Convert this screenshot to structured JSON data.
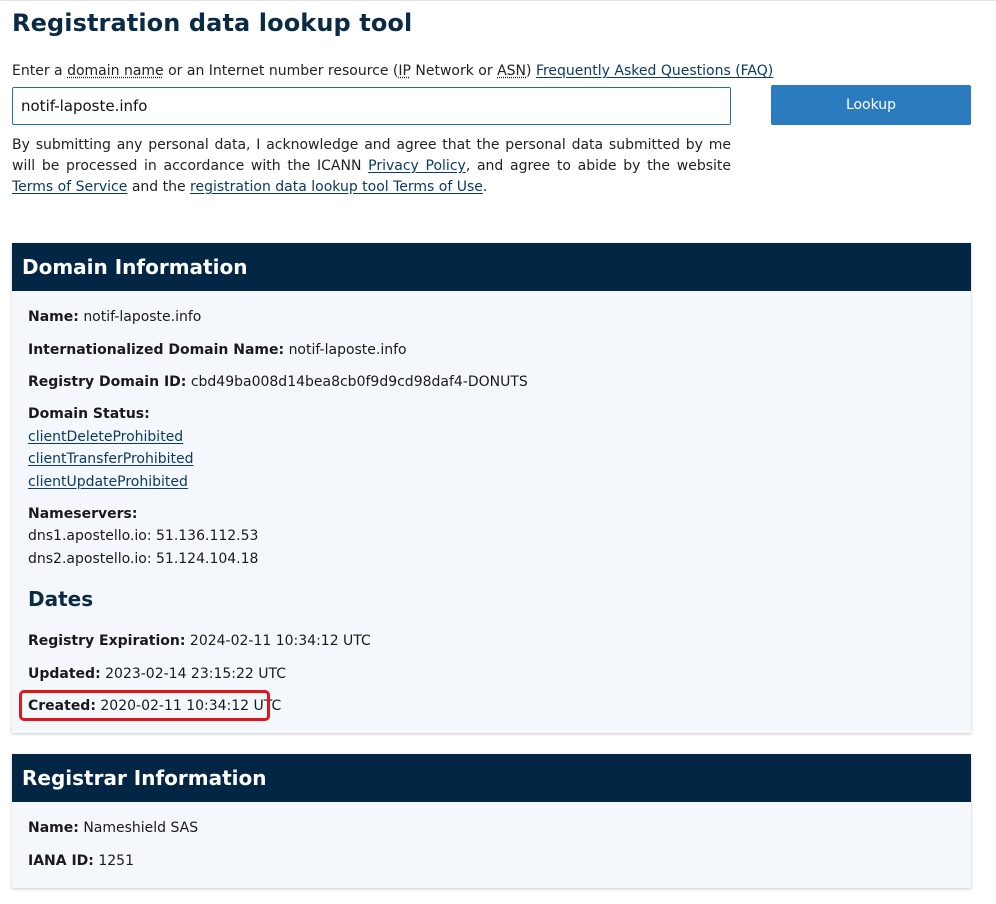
{
  "page": {
    "title": "Registration data lookup tool"
  },
  "search": {
    "prompt_prefix": "Enter a ",
    "prompt_domain_name": "domain name",
    "prompt_middle": " or an Internet number resource (",
    "prompt_ip": "IP",
    "prompt_network_or": " Network or ",
    "prompt_asn": "ASN",
    "prompt_suffix": ") ",
    "faq_link": "Frequently Asked Questions (FAQ)",
    "value": "notif-laposte.info",
    "lookup_label": "Lookup"
  },
  "consent": {
    "text1": "By submitting any personal data, I acknowledge and agree that the personal data submitted by me will be processed in accordance with the ICANN ",
    "privacy_link": "Privacy Policy",
    "text2": ", and agree to abide by the website ",
    "tos_link": "Terms of Service",
    "text3": " and the ",
    "terms_of_use_link": "registration data lookup tool Terms of Use",
    "text4": "."
  },
  "domain": {
    "header": "Domain Information",
    "name_label": "Name:",
    "name_value": "notif-laposte.info",
    "idn_label": "Internationalized Domain Name:",
    "idn_value": "notif-laposte.info",
    "registry_id_label": "Registry Domain ID:",
    "registry_id_value": "cbd49ba008d14bea8cb0f9d9cd98daf4-DONUTS",
    "status_label": "Domain Status:",
    "statuses": [
      "clientDeleteProhibited",
      "clientTransferProhibited",
      "clientUpdateProhibited"
    ],
    "nameservers_label": "Nameservers:",
    "nameservers": [
      "dns1.apostello.io: 51.136.112.53",
      "dns2.apostello.io: 51.124.104.18"
    ],
    "dates_heading": "Dates",
    "expiration_label": "Registry Expiration:",
    "expiration_value": "2024-02-11 10:34:12 UTC",
    "updated_label": "Updated:",
    "updated_value": "2023-02-14 23:15:22 UTC",
    "created_label": "Created:",
    "created_value": "2020-02-11 10:34:12 UTC"
  },
  "registrar": {
    "header": "Registrar Information",
    "name_label": "Name:",
    "name_value": "Nameshield SAS",
    "iana_label": "IANA ID:",
    "iana_value": "1251"
  },
  "colors": {
    "header_bg": "#032645",
    "button_bg": "#2b7bbf",
    "panel_bg": "#f4f8fc",
    "highlight": "#e0161b",
    "link": "#0b3a63"
  }
}
